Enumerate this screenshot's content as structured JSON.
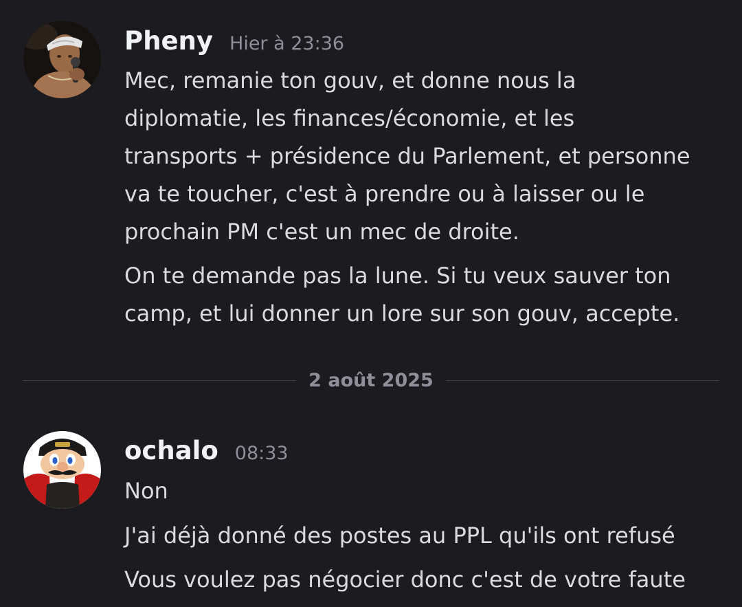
{
  "messages": [
    {
      "username": "Pheny",
      "timestamp": "Hier à 23:36",
      "avatar": "tupac-avatar",
      "lines": [
        "Mec, remanie ton gouv, et donne nous la",
        "diplomatie, les finances/économie, et les",
        "transports + présidence du Parlement, et personne",
        "va te toucher, c'est à prendre ou à laisser ou le",
        "prochain PM c'est un mec de droite.",
        "On te demande pas la lune. Si tu veux sauver ton",
        "camp, et lui donner un lore sur son gouv, accepte."
      ]
    },
    {
      "username": "ochalo",
      "timestamp": "08:33",
      "avatar": "mario-avatar",
      "lines": [
        "Non",
        "J'ai déjà donné des postes au PPL qu'ils ont refusé",
        "Vous voulez pas négocier donc c'est de votre faute"
      ]
    }
  ],
  "date_divider": "2 août 2025",
  "colors": {
    "background": "#1b1b20",
    "username": "#f2f3f5",
    "message_text": "#dbdbdf",
    "muted": "#8e8f98",
    "divider": "#3d3e45"
  }
}
